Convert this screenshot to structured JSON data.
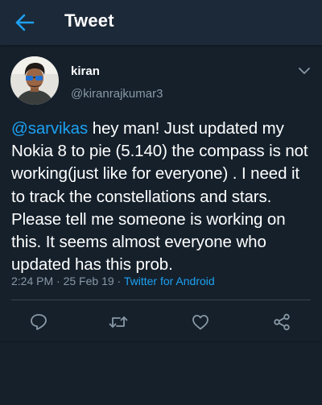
{
  "header": {
    "title": "Tweet",
    "back_icon": "arrow-left-icon"
  },
  "tweet": {
    "display_name": "kiran",
    "handle": "@kiranrajkumar3",
    "mention": "@sarvikas",
    "text": " hey man! Just updated my Nokia 8 to pie (5.140) the compass is not working(just like for everyone) . I need it to track the constellations and stars. Please tell me someone is working on this. It seems almost everyone who updated has this prob.",
    "time": "2:24 PM",
    "date": "25 Feb 19",
    "separator": "·",
    "source": "Twitter for Android"
  },
  "actions": {
    "reply_icon": "reply-icon",
    "retweet_icon": "retweet-icon",
    "like_icon": "heart-icon",
    "share_icon": "share-icon"
  },
  "colors": {
    "background": "#15202b",
    "header": "#1c2938",
    "accent": "#1da1f2",
    "secondary_text": "#8899a6",
    "divider": "#38444d"
  }
}
